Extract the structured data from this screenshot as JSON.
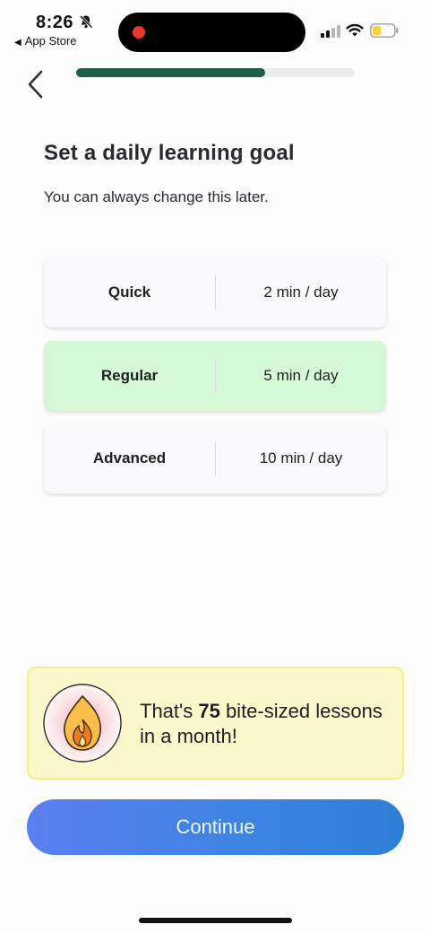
{
  "status_bar": {
    "time": "8:26",
    "back_app_label": "App Store",
    "back_app_arrow": "◀",
    "battery_color": "#f5d33b"
  },
  "nav": {
    "back_icon": "chevron-left-icon",
    "progress_fraction": 0.68,
    "progress_color": "#1f5e48"
  },
  "header": {
    "title": "Set a daily learning goal",
    "subtitle": "You can always change this later."
  },
  "options": [
    {
      "name": "Quick",
      "time": "2 min / day",
      "selected": false
    },
    {
      "name": "Regular",
      "time": "5 min / day",
      "selected": true
    },
    {
      "name": "Advanced",
      "time": "10 min / day",
      "selected": false
    }
  ],
  "info_card": {
    "icon": "flame-icon",
    "text_prefix": "That's ",
    "count": "75",
    "text_suffix": " bite-sized lessons in a month!"
  },
  "continue_label": "Continue",
  "colors": {
    "selected_option": "#d5f8d6",
    "info_bg": "#fdf8cb",
    "button_start": "#5b7ff0",
    "button_end": "#2e7fd6"
  }
}
